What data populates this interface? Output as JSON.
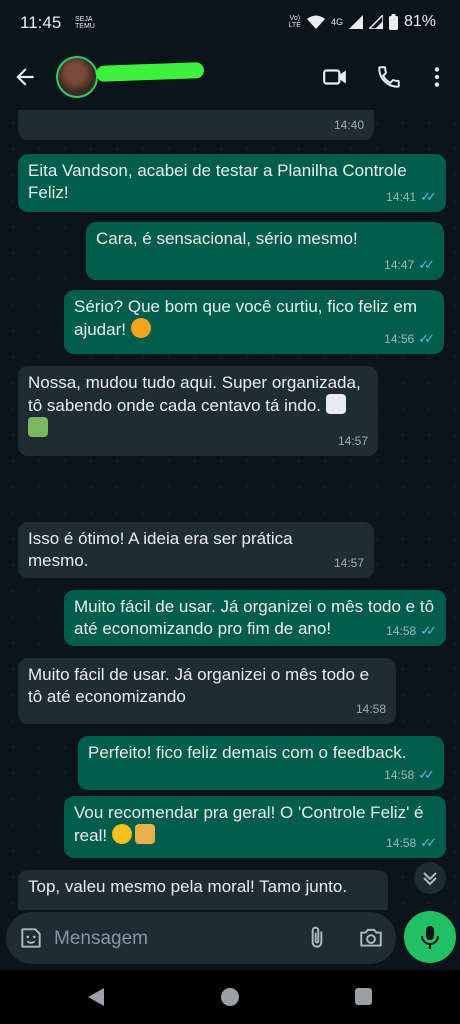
{
  "status_bar": {
    "time": "11:45",
    "small_label": "SEJA TEMU",
    "network_top": "Vo)",
    "network_bottom": "LTE",
    "signal": "4G",
    "battery": "81%"
  },
  "header": {
    "contact_name": "",
    "icons": [
      "back-arrow-icon",
      "video-call-icon",
      "voice-call-icon",
      "more-options-icon"
    ]
  },
  "messages": [
    {
      "direction": "incoming",
      "text": "",
      "time": "14:40",
      "read": false
    },
    {
      "direction": "outgoing",
      "text": "Eita Vandson, acabei de testar a Planilha Controle Feliz!",
      "time": "14:41",
      "read": true
    },
    {
      "direction": "outgoing",
      "text": "Cara, é sensacional, sério mesmo!",
      "time": "14:47",
      "read": true
    },
    {
      "direction": "outgoing",
      "text": "Sério? Que bom que você curtiu, fico feliz em ajudar!",
      "time": "14:56",
      "read": true,
      "emoji": [
        "star-struck"
      ]
    },
    {
      "direction": "incoming",
      "text": "Nossa, mudou tudo aqui. Super organizada, tô sabendo onde cada centavo tá indo.",
      "time": "14:57",
      "emoji": [
        "bar-chart",
        "money-with-wings"
      ]
    },
    {
      "direction": "incoming",
      "text": "Isso é ótimo! A ideia era ser prática mesmo.",
      "time": "14:57"
    },
    {
      "direction": "outgoing",
      "text": "Muito fácil de usar. Já organizei o mês todo e tô até economizando pro fim de ano!",
      "time": "14:58",
      "read": true
    },
    {
      "direction": "incoming",
      "text": "Muito fácil de usar. Já organizei o mês todo e tô até economizando",
      "time": "14:58"
    },
    {
      "direction": "outgoing",
      "text": "Perfeito! fico feliz demais com o feedback.",
      "time": "14:58",
      "read": true
    },
    {
      "direction": "outgoing",
      "text": "Vou recomendar pra geral! O 'Controle Feliz' é real!",
      "time": "14:58",
      "read": true,
      "emoji": [
        "tears-of-joy",
        "raising-hands"
      ]
    },
    {
      "direction": "incoming",
      "text": "Top, valeu mesmo pela moral! Tamo junto.",
      "time": ""
    }
  ],
  "composer": {
    "placeholder": "Mensagem"
  },
  "colors": {
    "background": "#0b141a",
    "incoming_bubble": "#202c33",
    "outgoing_bubble": "#005c4b",
    "accent": "#21c063",
    "read_ticks": "#53bdeb"
  }
}
